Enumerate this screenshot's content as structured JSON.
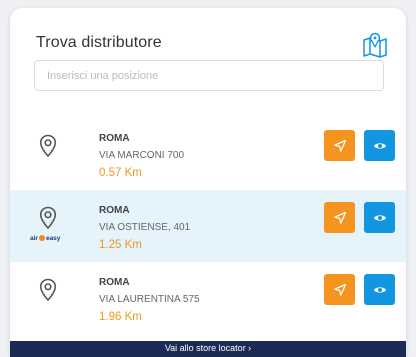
{
  "header": {
    "title": "Trova distributore",
    "map_icon": "map-pin-icon"
  },
  "search": {
    "placeholder": "Inserisci una posizione",
    "value": ""
  },
  "stores": [
    {
      "city": "ROMA",
      "address": "VIA MARCONI 700",
      "distance": "0.57 Km",
      "highlighted": false,
      "brand": ""
    },
    {
      "city": "ROMA",
      "address": "VIA OSTIENSE, 401",
      "distance": "1.25 Km",
      "highlighted": true,
      "brand_prefix": "air",
      "brand_suffix": "easy"
    },
    {
      "city": "ROMA",
      "address": "VIA LAURENTINA 575",
      "distance": "1.96 Km",
      "highlighted": false,
      "brand": ""
    }
  ],
  "icons": {
    "pin": "location-pin-icon",
    "navigate": "navigation-arrow-icon",
    "view": "eye-icon"
  },
  "colors": {
    "accent_orange": "#f5931f",
    "accent_blue": "#1296e0",
    "footer_bg": "#1c2a55",
    "highlight_bg": "#e5f3fb"
  },
  "footer": {
    "link_label": "Vai allo store locator ›"
  }
}
